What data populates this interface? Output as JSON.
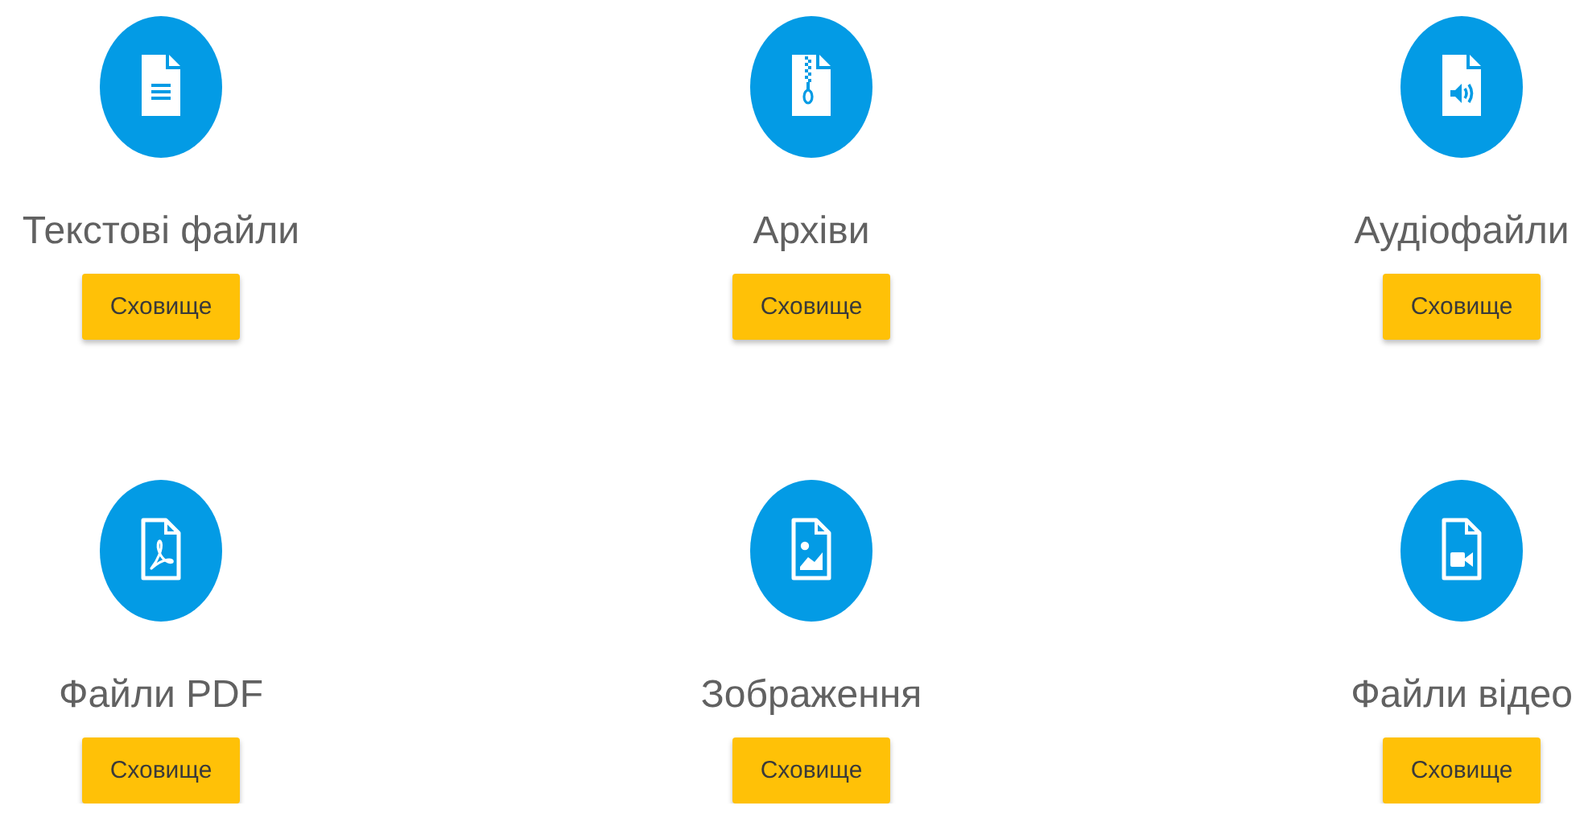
{
  "categories": [
    {
      "kind": "text",
      "label": "Текстові файли",
      "button": "Сховище"
    },
    {
      "kind": "archive",
      "label": "Архіви",
      "button": "Сховище"
    },
    {
      "kind": "audio",
      "label": "Аудіофайли",
      "button": "Сховище"
    },
    {
      "kind": "pdf",
      "label": "Файли PDF",
      "button": "Сховище"
    },
    {
      "kind": "image",
      "label": "Зображення",
      "button": "Сховище"
    },
    {
      "kind": "video",
      "label": "Файли відео",
      "button": "Сховище"
    }
  ]
}
